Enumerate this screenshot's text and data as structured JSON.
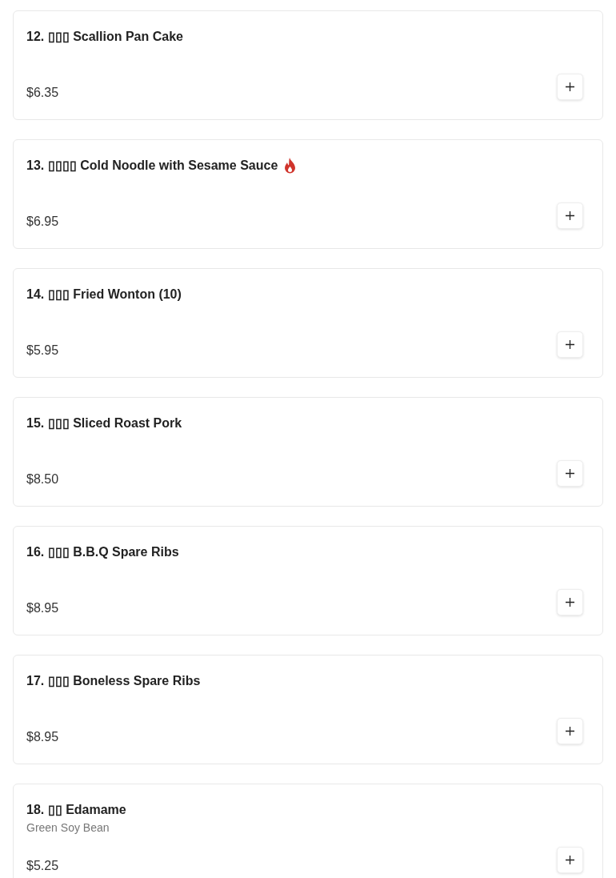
{
  "menu_items": [
    {
      "title": "12. ▯▯▯ Scallion Pan Cake",
      "spicy": false,
      "price": "$6.35"
    },
    {
      "title": "13. ▯▯▯▯ Cold Noodle with Sesame Sauce",
      "spicy": true,
      "price": "$6.95"
    },
    {
      "title": "14. ▯▯▯ Fried Wonton (10)",
      "spicy": false,
      "price": "$5.95"
    },
    {
      "title": "15. ▯▯▯ Sliced Roast Pork",
      "spicy": false,
      "price": "$8.50"
    },
    {
      "title": "16. ▯▯▯ B.B.Q Spare Ribs",
      "spicy": false,
      "price": "$8.95"
    },
    {
      "title": "17. ▯▯▯ Boneless Spare Ribs",
      "spicy": false,
      "price": "$8.95"
    },
    {
      "title": "18. ▯▯ Edamame",
      "description": "Green Soy Bean",
      "spicy": false,
      "price": "$5.25"
    }
  ]
}
